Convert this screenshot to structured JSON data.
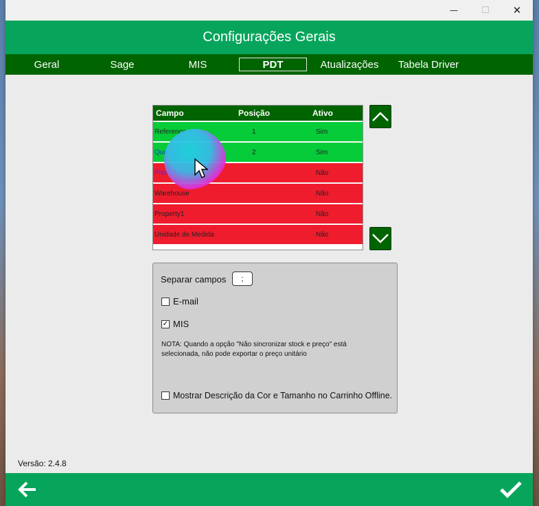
{
  "window": {
    "title": "Configurações Gerais",
    "minimize_glyph": "—",
    "maximize_glyph": "☐",
    "close_glyph": "✕"
  },
  "tabs": [
    {
      "label": "Geral",
      "active": false
    },
    {
      "label": "Sage",
      "active": false
    },
    {
      "label": "MIS",
      "active": false
    },
    {
      "label": "PDT",
      "active": true
    },
    {
      "label": "Atualizações",
      "active": false
    },
    {
      "label": "Tabela Driver",
      "active": false
    }
  ],
  "grid": {
    "columns": [
      "Campo",
      "Posição",
      "Ativo"
    ],
    "rows": [
      {
        "campo": "Reference",
        "posicao": "1",
        "ativo": "Sim",
        "status": "green"
      },
      {
        "campo": "Quantity",
        "posicao": "2",
        "ativo": "Sim",
        "status": "green"
      },
      {
        "campo": "Priceline",
        "posicao": "",
        "ativo": "Não",
        "status": "red"
      },
      {
        "campo": "Warehouse",
        "posicao": "",
        "ativo": "Não",
        "status": "red"
      },
      {
        "campo": "Property1",
        "posicao": "",
        "ativo": "Não",
        "status": "red"
      },
      {
        "campo": "Unidade de Medida",
        "posicao": "",
        "ativo": "Não",
        "status": "red"
      }
    ]
  },
  "options": {
    "separator_label": "Separar campos",
    "separator_value": ";",
    "email_label": "E-mail",
    "email_checked": false,
    "mis_label": "MIS",
    "mis_checked": true,
    "note": "NOTA: Quando a opção \"Não sincronizar stock e preço\" está selecionada, não pode exportar o preço unitário",
    "show_desc_label": "Mostrar Descrição da Cor e Tamanho no Carrinho Offline.",
    "show_desc_checked": false
  },
  "version": "Versão: 2.4.8",
  "colors": {
    "header_green": "#07a55c",
    "dark_green": "#006400",
    "row_green": "#05cc38",
    "row_red": "#ee1c2d"
  },
  "icons": {
    "up": "chevron-up-icon",
    "down": "chevron-down-icon",
    "back": "arrow-left-icon",
    "confirm": "checkmark-icon"
  }
}
